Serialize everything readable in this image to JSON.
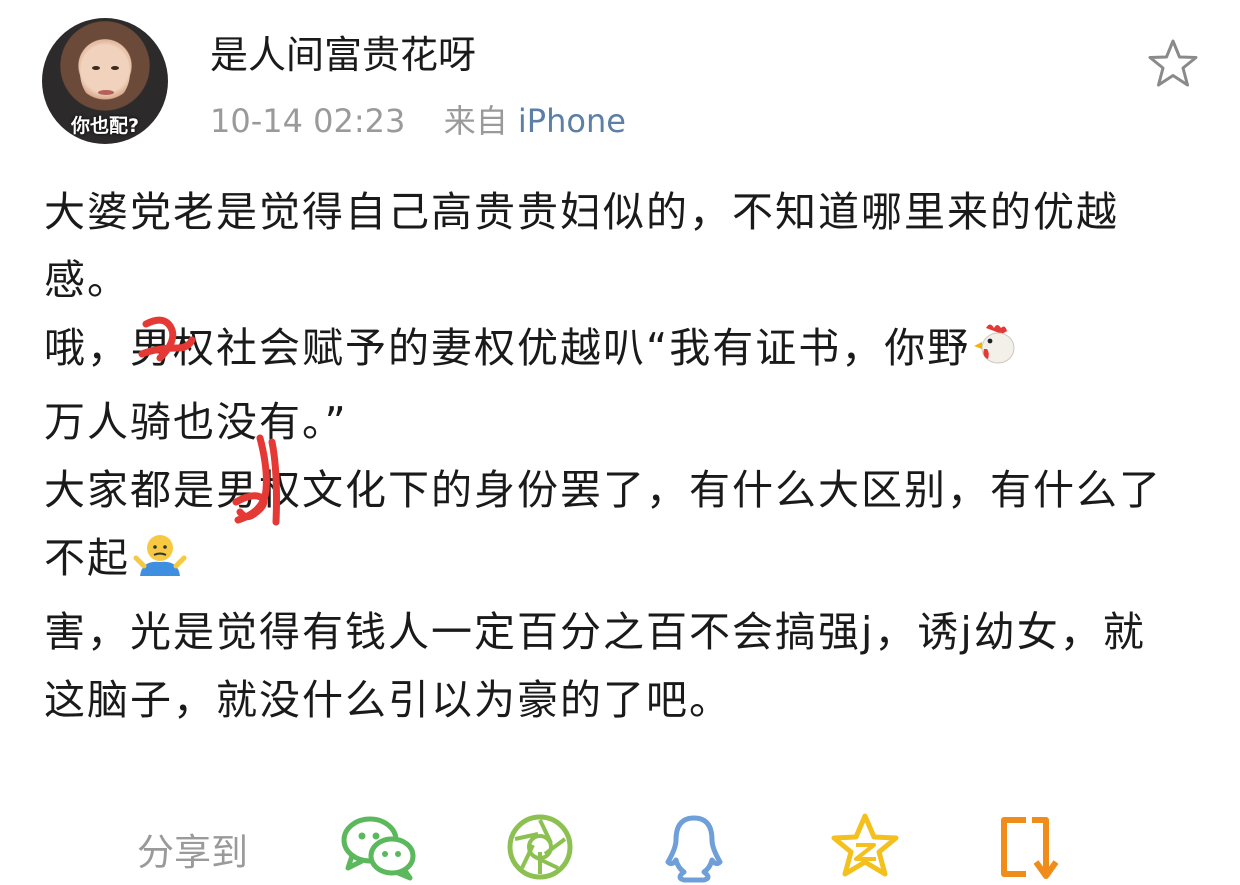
{
  "post": {
    "username": "是人间富贵花呀",
    "timestamp": "10-14 02:23",
    "source_prefix": "来自",
    "source": "iPhone",
    "avatar_caption": "你也配?"
  },
  "content": {
    "p1": "大婆党老是觉得自己高贵贵妇似的，不知道哪里来的优越感。",
    "p2a": "哦，男权社会赋予的妻权优越叭“我有证书，你野",
    "p2b": "万人骑也没有。”",
    "p3a": "大家都是男权文化下的身份罢了，有什么大区别，有什么了不起",
    "p4": "害，光是觉得有钱人一定百分之百不会搞强j，诱j幼女，就这脑子，就没什么引以为豪的了吧。"
  },
  "share": {
    "label": "分享到",
    "icons": [
      "wechat-icon",
      "moments-icon",
      "qq-icon",
      "qzone-icon",
      "weibo-icon"
    ],
    "colors": {
      "green": "#5cb85c",
      "blue": "#6f9fd8",
      "yellow": "#f4c01e",
      "orange": "#f08c1a"
    }
  },
  "accent": {
    "source_link": "#5b7fa6",
    "meta_gray": "#9a9a9a",
    "scribble_red": "#e53935"
  }
}
